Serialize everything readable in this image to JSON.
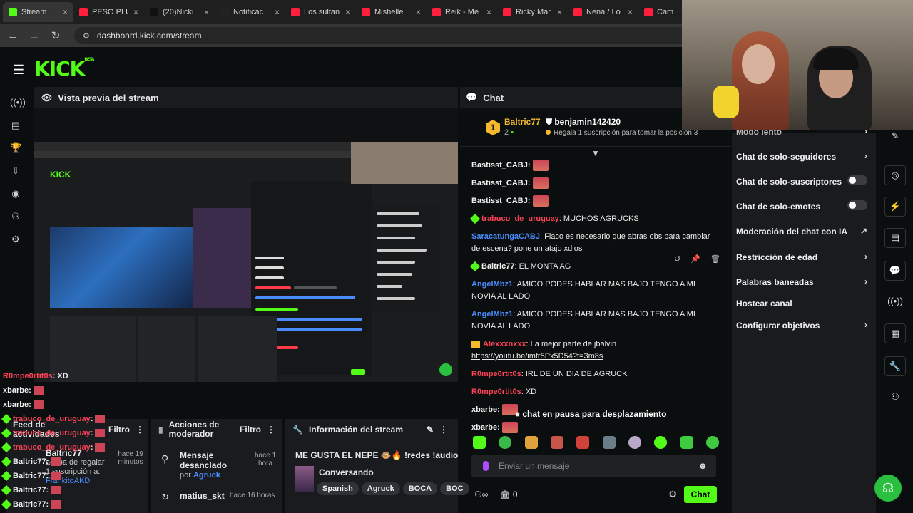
{
  "browser": {
    "tabs": [
      {
        "title": "Stream",
        "color": "#53fc18"
      },
      {
        "title": "PESO PLU",
        "color": "#ff1f3d"
      },
      {
        "title": "(20)Nicki",
        "color": "#111111"
      },
      {
        "title": "Notificac",
        "color": "#222222"
      },
      {
        "title": "Los sultan",
        "color": "#ff1f3d"
      },
      {
        "title": "Mishelle",
        "color": "#ff1f3d"
      },
      {
        "title": "Reik - Me",
        "color": "#ff1f3d"
      },
      {
        "title": "Ricky Mar",
        "color": "#ff1f3d"
      },
      {
        "title": "Nena / Lo",
        "color": "#ff1f3d"
      },
      {
        "title": "Cam",
        "color": "#ff1f3d"
      }
    ],
    "url": "dashboard.kick.com/stream"
  },
  "logo": "KICK",
  "logo_badge": "BETA",
  "preview": {
    "title": "Vista previa del stream"
  },
  "chat": {
    "title": "Chat",
    "pinned": {
      "rank": "1",
      "user": "Baltric77",
      "count": "2",
      "user2": "benjamin142420",
      "gift_text": "Regala 1 suscripción para tomar la posición 3"
    },
    "messages": [
      {
        "user": "Bastisst_CABJ:",
        "color": "#f0f0f0",
        "text": "",
        "emote": true
      },
      {
        "user": "Bastisst_CABJ:",
        "color": "#f0f0f0",
        "text": "",
        "emote": true
      },
      {
        "user": "Bastisst_CABJ:",
        "color": "#f0f0f0",
        "text": "",
        "emote": true
      },
      {
        "user": "trabuco_de_uruguay",
        "color": "#ff4257",
        "text": ": MUCHOS AGRUCKS",
        "badge": "g"
      },
      {
        "user": "SaracatungaCABJ",
        "color": "#4a8cff",
        "text": ": Flaco es necesario que abras obs para cambiar de escena? pone un atajo xdios"
      },
      {
        "user": "Baltric77",
        "color": "#f0f0f0",
        "text": ": EL MONTA AG",
        "badge": "g"
      },
      {
        "user": "AngelMbz1",
        "color": "#4a8cff",
        "text": ": AMIGO PODES HABLAR MAS BAJO TENGO A MI NOVIA AL LADO"
      },
      {
        "user": "AngelMbz1",
        "color": "#4a8cff",
        "text": ": AMIGO PODES HABLAR MAS BAJO TENGO A MI NOVIA AL LADO"
      },
      {
        "user": "Alexxxnxxx",
        "color": "#ff4257",
        "text": ": La mejor parte de jbalvin",
        "link": "https://youtu.be/imfr5Px5D54?t=3m8s",
        "badge": "y"
      },
      {
        "user": "R0mpe0rtit0s",
        "color": "#ff4257",
        "text": ": IRL DE UN DIA DE AGRUCK"
      },
      {
        "user": "R0mpe0rtit0s",
        "color": "#ff4257",
        "text": ": XD"
      },
      {
        "user": "xbarbe:",
        "color": "#f0f0f0",
        "text": "",
        "emote": true
      },
      {
        "user": "xbarbe:",
        "color": "#f0f0f0",
        "text": "",
        "emote": true
      }
    ],
    "paused": "chat en pausa para desplazamiento",
    "input_placeholder": "Enviar un mensaje",
    "footer_count": "0",
    "send_label": "Chat"
  },
  "menu": {
    "top_partial": "Modo lento",
    "items": [
      {
        "label": "Chat de solo-seguidores",
        "kind": "chev"
      },
      {
        "label": "Chat de solo-suscriptores",
        "kind": "toggle"
      },
      {
        "label": "Chat de solo-emotes",
        "kind": "toggle"
      },
      {
        "label": "Moderación del chat con IA",
        "kind": "ext"
      },
      {
        "label": "Restricción de edad",
        "kind": "chev"
      },
      {
        "label": "Palabras baneadas",
        "kind": "chev"
      },
      {
        "label": "Hostear canal",
        "kind": "none"
      },
      {
        "label": "Configurar objetivos",
        "kind": "chev"
      }
    ]
  },
  "overlay_chat": [
    {
      "user": "R0mpe0rtit0s",
      "text": ": XD",
      "color": "#ff4257"
    },
    {
      "user": "xbarbe",
      "text": ":",
      "color": "#f0f0f0"
    },
    {
      "user": "xbarbe",
      "text": ":",
      "color": "#f0f0f0"
    },
    {
      "user": "trabuco_de_uruguay",
      "text": ":",
      "color": "#ff4257"
    },
    {
      "user": "trabuco_de_uruguay",
      "text": ":",
      "color": "#ff4257"
    },
    {
      "user": "trabuco_de_uruguay",
      "text": ":",
      "color": "#ff4257"
    },
    {
      "user": "Baltric77",
      "text": ":",
      "color": "#f0f0f0"
    },
    {
      "user": "Baltric77",
      "text": ":",
      "color": "#f0f0f0"
    },
    {
      "user": "Baltric77",
      "text": ":",
      "color": "#f0f0f0"
    },
    {
      "user": "Baltric77",
      "text": ":",
      "color": "#f0f0f0"
    }
  ],
  "feed": {
    "title": "Feed de actividades",
    "filter": "Filtro",
    "item_user": "Baltric77",
    "item_text": "acaba de regalar 1 suscripción a:",
    "item_target": "FrankitoAKD",
    "item_time": "hace 19 minutos"
  },
  "mod_actions": {
    "title": "Acciones de moderador",
    "filter": "Filtro",
    "items": [
      {
        "title": "Mensaje desanclado",
        "by": "por",
        "user": "Agruck",
        "time": "hace 1 hora"
      },
      {
        "title": "matius_skt",
        "time": "hace 16 horas"
      }
    ]
  },
  "stream_info": {
    "title": "Información del stream",
    "stream_title": "ME GUSTA EL NEPE 🐵🔥 !redes !audio",
    "category": "Conversando",
    "tags": [
      "Spanish",
      "Agruck",
      "BOCA",
      "BOC"
    ]
  }
}
